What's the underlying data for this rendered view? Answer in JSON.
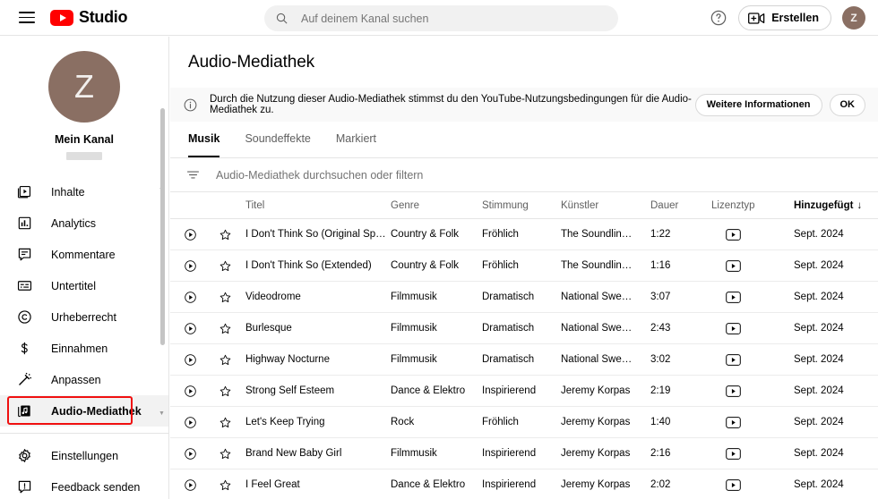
{
  "topbar": {
    "menu_icon": "hamburger-icon",
    "brand": "Studio",
    "search_placeholder": "Auf deinem Kanal suchen",
    "search_value": "",
    "help_icon": "help-circle-icon",
    "create_label": "Erstellen",
    "avatar_letter": "Z"
  },
  "sidebar": {
    "avatar_letter": "Z",
    "channel_name": "Mein Kanal",
    "items": [
      {
        "label": "Inhalte",
        "icon": "content-video-icon",
        "active": false
      },
      {
        "label": "Analytics",
        "icon": "bar-chart-icon",
        "active": false
      },
      {
        "label": "Kommentare",
        "icon": "comment-icon",
        "active": false
      },
      {
        "label": "Untertitel",
        "icon": "subtitles-icon",
        "active": false
      },
      {
        "label": "Urheberrecht",
        "icon": "copyright-icon",
        "active": false
      },
      {
        "label": "Einnahmen",
        "icon": "dollar-icon",
        "active": false
      },
      {
        "label": "Anpassen",
        "icon": "magic-wand-icon",
        "active": false
      },
      {
        "label": "Audio-Mediathek",
        "icon": "audio-library-icon",
        "active": true
      }
    ],
    "footer_items": [
      {
        "label": "Einstellungen",
        "icon": "gear-icon"
      },
      {
        "label": "Feedback senden",
        "icon": "feedback-icon"
      }
    ]
  },
  "main": {
    "page_title": "Audio-Mediathek",
    "banner": {
      "icon": "info-icon",
      "text": "Durch die Nutzung dieser Audio-Mediathek stimmst du den YouTube-Nutzungsbedingungen für die Audio-Mediathek zu.",
      "more_label": "Weitere Informationen",
      "ok_label": "OK"
    },
    "tabs": [
      {
        "label": "Musik",
        "active": true
      },
      {
        "label": "Soundeffekte",
        "active": false
      },
      {
        "label": "Markiert",
        "active": false
      }
    ],
    "filter": {
      "icon": "filter-icon",
      "placeholder": "Audio-Mediathek durchsuchen oder filtern",
      "value": ""
    },
    "table": {
      "columns": [
        "Titel",
        "Genre",
        "Stimmung",
        "Künstler",
        "Dauer",
        "Lizenztyp",
        "Hinzugefügt"
      ],
      "sorted_column": "Hinzugefügt",
      "sort_direction": "↓",
      "rows": [
        {
          "title": "I Don't Think So (Original Speed)",
          "genre": "Country & Folk",
          "mood": "Fröhlich",
          "artist": "The Soundlin…",
          "duration": "1:22",
          "license": "youtube-license-icon",
          "added": "Sept. 2024"
        },
        {
          "title": "I Don't Think So (Extended)",
          "genre": "Country & Folk",
          "mood": "Fröhlich",
          "artist": "The Soundlin…",
          "duration": "1:16",
          "license": "youtube-license-icon",
          "added": "Sept. 2024"
        },
        {
          "title": "Videodrome",
          "genre": "Filmmusik",
          "mood": "Dramatisch",
          "artist": "National Swe…",
          "duration": "3:07",
          "license": "youtube-license-icon",
          "added": "Sept. 2024"
        },
        {
          "title": "Burlesque",
          "genre": "Filmmusik",
          "mood": "Dramatisch",
          "artist": "National Swe…",
          "duration": "2:43",
          "license": "youtube-license-icon",
          "added": "Sept. 2024"
        },
        {
          "title": "Highway Nocturne",
          "genre": "Filmmusik",
          "mood": "Dramatisch",
          "artist": "National Swe…",
          "duration": "3:02",
          "license": "youtube-license-icon",
          "added": "Sept. 2024"
        },
        {
          "title": "Strong Self Esteem",
          "genre": "Dance & Elektro",
          "mood": "Inspirierend",
          "artist": "Jeremy Korpas",
          "duration": "2:19",
          "license": "youtube-license-icon",
          "added": "Sept. 2024"
        },
        {
          "title": "Let's Keep Trying",
          "genre": "Rock",
          "mood": "Fröhlich",
          "artist": "Jeremy Korpas",
          "duration": "1:40",
          "license": "youtube-license-icon",
          "added": "Sept. 2024"
        },
        {
          "title": "Brand New Baby Girl",
          "genre": "Filmmusik",
          "mood": "Inspirierend",
          "artist": "Jeremy Korpas",
          "duration": "2:16",
          "license": "youtube-license-icon",
          "added": "Sept. 2024"
        },
        {
          "title": "I Feel Great",
          "genre": "Dance & Elektro",
          "mood": "Inspirierend",
          "artist": "Jeremy Korpas",
          "duration": "2:02",
          "license": "youtube-license-icon",
          "added": "Sept. 2024"
        }
      ]
    }
  },
  "annotation": {
    "highlight_color": "#f01010",
    "target": "Audio-Mediathek"
  }
}
